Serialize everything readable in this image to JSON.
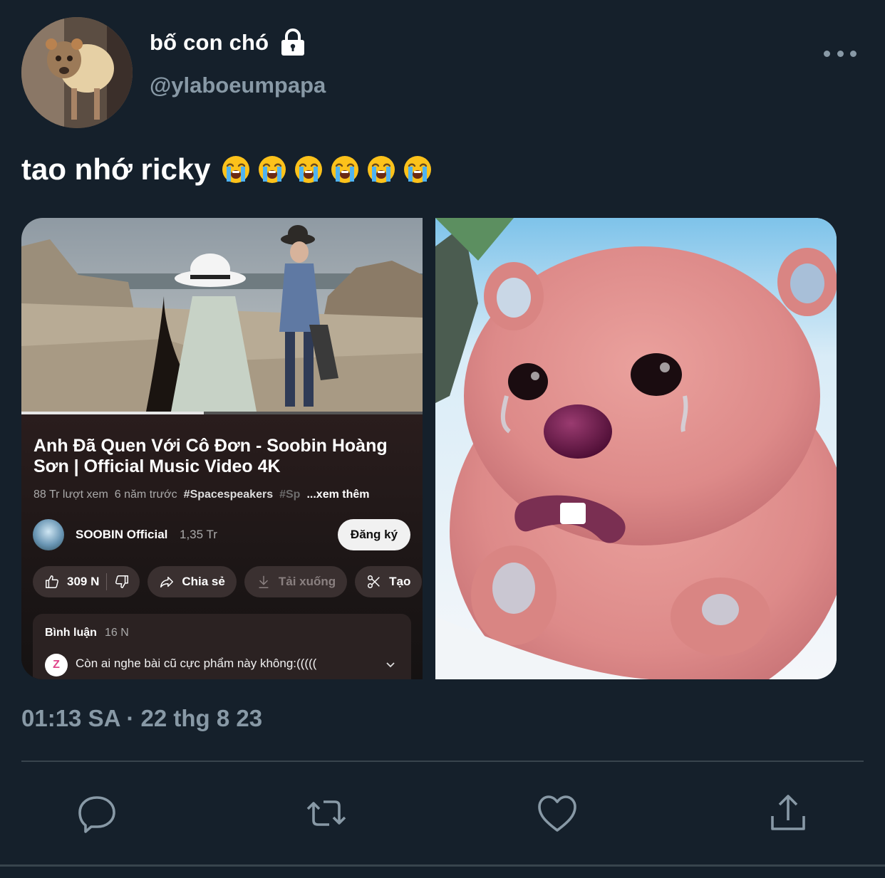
{
  "user": {
    "display_name": "bố con chó",
    "handle": "@ylaboeumpapa",
    "avatar_icon": "dog-photo",
    "protected_icon": "lock-icon"
  },
  "tweet": {
    "text": "tao nhớ ricky",
    "emoji": [
      "😭",
      "😭",
      "😭",
      "😭",
      "😭",
      "😭"
    ],
    "timestamp": "01:13 SA · 22 thg 8 23"
  },
  "video": {
    "title": "Anh Đã Quen Với Cô Đơn - Soobin Hoàng Sơn | Official Music Video 4K",
    "views": "88 Tr lượt xem",
    "age": "6 năm trước",
    "hashtag": "#Spacespeakers",
    "hashtag_faded": "#Sp",
    "more": "...xem thêm",
    "channel_name": "SOOBIN Official",
    "subscribers": "1,35 Tr",
    "subscribe_label": "Đăng ký",
    "likes": "309 N",
    "share_label": "Chia sẻ",
    "download_label": "Tải xuống",
    "create_label": "Tạo",
    "progress": 0.455,
    "comments_label": "Bình luận",
    "comments_count": "16 N",
    "comment_avatar": "Z",
    "top_comment": "Còn ai nghe bài cũ cực phẩm này không:((((("
  },
  "actions": {
    "icons": [
      "reply-icon",
      "retweet-icon",
      "like-icon",
      "share-icon"
    ]
  },
  "colors": {
    "background": "#15202b",
    "secondary_text": "#8899a6",
    "divider": "#38444d"
  }
}
